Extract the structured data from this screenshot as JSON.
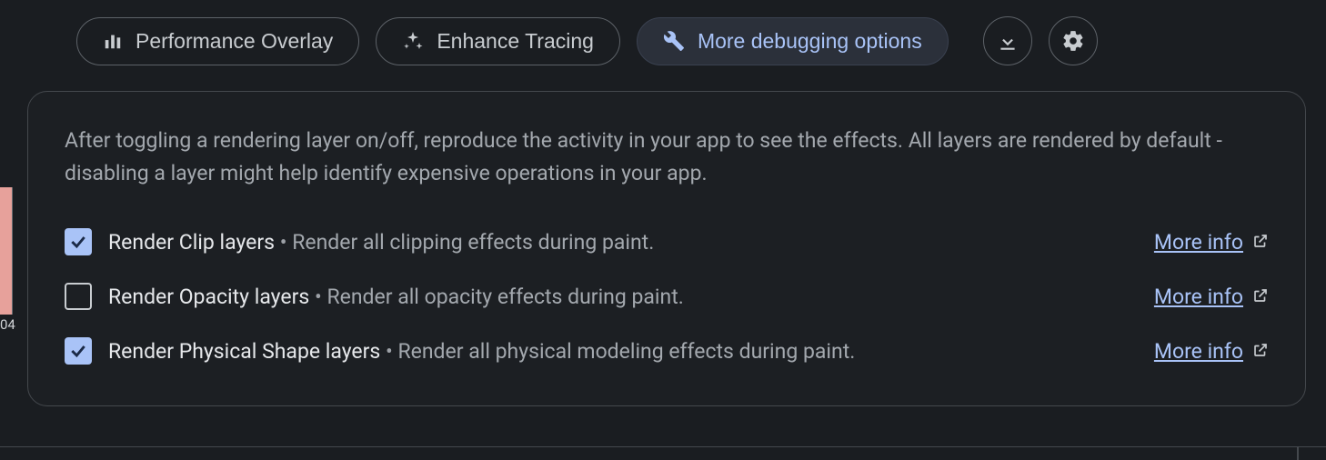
{
  "toolbar": {
    "buttons": [
      {
        "label": "Performance Overlay"
      },
      {
        "label": "Enhance Tracing"
      },
      {
        "label": "More debugging options"
      }
    ]
  },
  "panel": {
    "description": "After toggling a rendering layer on/off, reproduce the activity in your app to see the effects. All layers are rendered by default - disabling a layer might help identify expensive operations in your app.",
    "more_info_label": "More info",
    "options": [
      {
        "checked": true,
        "label": "Render Clip layers",
        "desc": "Render all clipping effects during paint."
      },
      {
        "checked": false,
        "label": "Render Opacity layers",
        "desc": "Render all opacity effects during paint."
      },
      {
        "checked": true,
        "label": "Render Physical Shape layers",
        "desc": "Render all physical modeling effects during paint."
      }
    ]
  },
  "side": {
    "label": "04"
  }
}
